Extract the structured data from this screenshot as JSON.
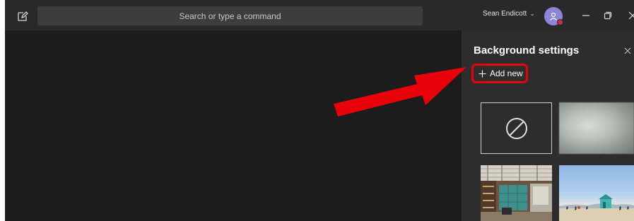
{
  "titlebar": {
    "search_placeholder": "Search or type a command",
    "user_name": "Sean Endicott",
    "icons": [
      "compose-icon",
      "chevron-down-icon",
      "avatar",
      "minimize-icon",
      "restore-icon",
      "close-icon"
    ]
  },
  "panel": {
    "title": "Background settings",
    "add_new_label": "Add new",
    "tiles": [
      "none",
      "blur",
      "office",
      "beach"
    ]
  },
  "colors": {
    "app_bg": "#1f1f1f",
    "titlebar_bg": "#292929",
    "panel_bg": "#2d2d2d",
    "highlight": "#e8000a",
    "avatar": "#8b86d6",
    "presence": "#c4314b"
  }
}
